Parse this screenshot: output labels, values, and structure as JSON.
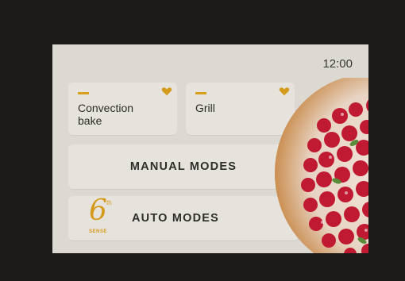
{
  "status_bar": {
    "time": "12:00"
  },
  "favorites": [
    {
      "label": "Convection bake",
      "icon": "heart-icon"
    },
    {
      "label": "Grill",
      "icon": "heart-icon"
    }
  ],
  "menu": {
    "manual_label": "MANUAL MODES",
    "auto_label": "AUTO MODES",
    "auto_logo": {
      "number": "6",
      "superscript": "th",
      "word": "SENSE"
    }
  },
  "colors": {
    "accent": "#d69a1a",
    "screen_bg": "#dcd9d2",
    "tile_bg": "#e6e3dc",
    "bezel": "#1d1b19",
    "berry": "#c01a32"
  }
}
